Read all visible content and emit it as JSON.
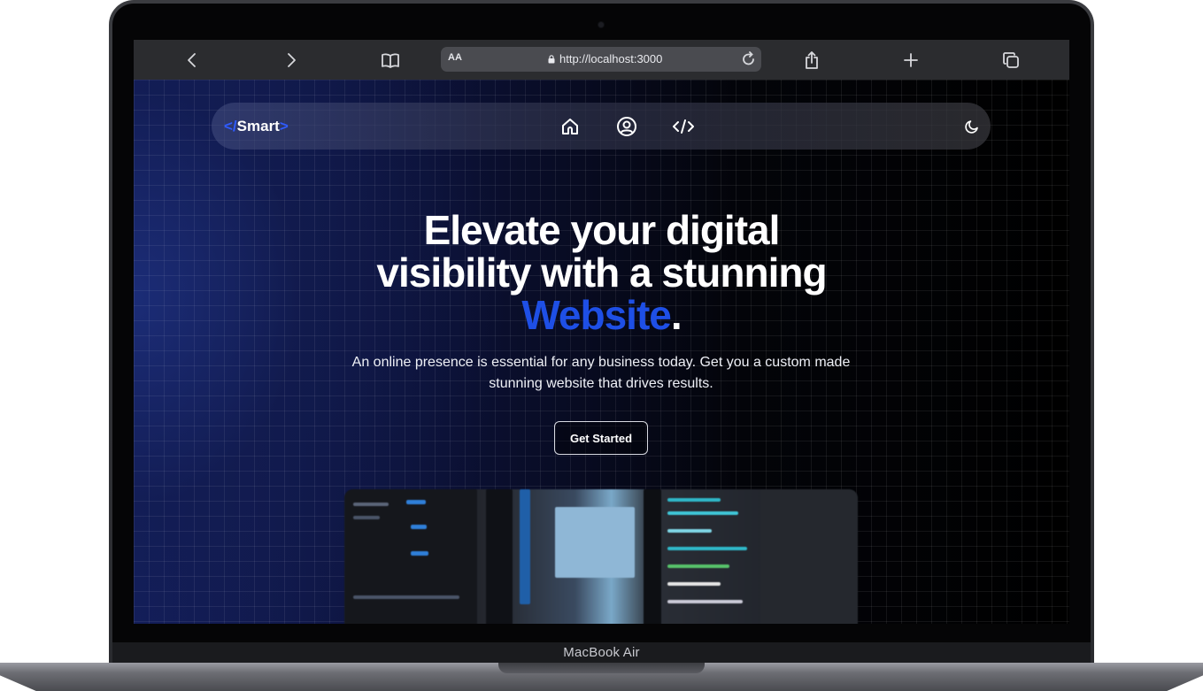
{
  "device": {
    "label": "MacBook Air"
  },
  "browser": {
    "text_size_label": "AA",
    "url": "http://localhost:3000",
    "icons": [
      "back-icon",
      "forward-icon",
      "bookmarks-icon",
      "lock-icon",
      "reload-icon",
      "share-icon",
      "new-tab-icon",
      "tabs-overview-icon"
    ]
  },
  "site": {
    "logo": {
      "open": "</",
      "name": "Smart",
      "close": ">"
    },
    "nav_icons": [
      "home-icon",
      "profile-icon",
      "code-icon",
      "dark-mode-icon"
    ],
    "hero": {
      "title_line1": "Elevate your digital",
      "title_line2": "visibility with a stunning",
      "title_accent": "Website",
      "title_end": ".",
      "subtitle": "An online presence is essential for any business today. Get you a custom made stunning website that drives results.",
      "cta": "Get Started"
    },
    "colors": {
      "accent": "#1e4fe6",
      "logo_bracket": "#2f5bff",
      "background": "#000000"
    }
  }
}
